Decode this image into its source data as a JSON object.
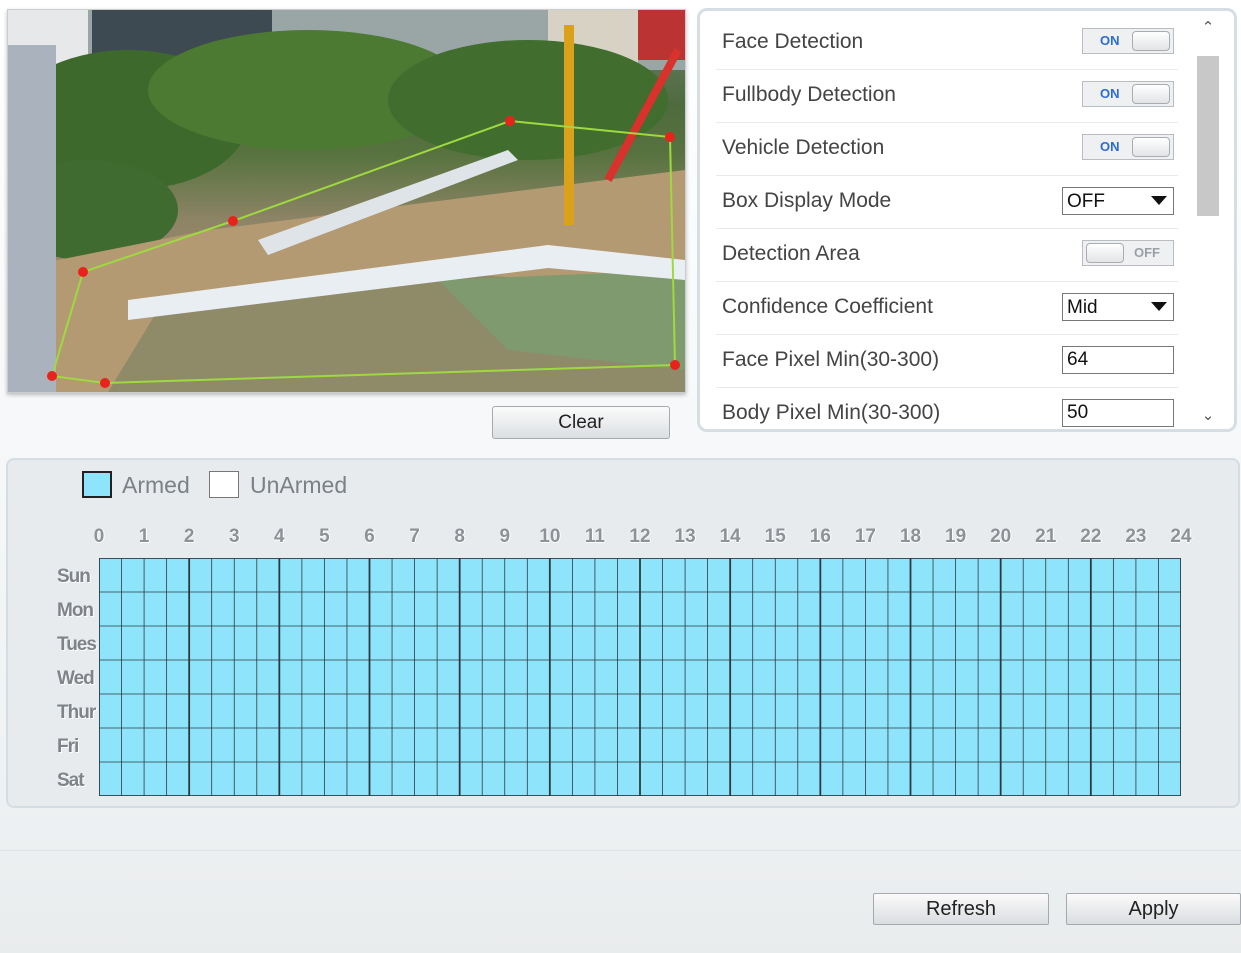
{
  "preview": {
    "clear_label": "Clear",
    "colors": {
      "region_line": "#9fd940",
      "region_point": "#e8231c"
    }
  },
  "settings": {
    "rows": [
      {
        "label": "Face Detection",
        "control": "toggle",
        "value": "ON"
      },
      {
        "label": "Fullbody Detection",
        "control": "toggle",
        "value": "ON"
      },
      {
        "label": "Vehicle Detection",
        "control": "toggle",
        "value": "ON"
      },
      {
        "label": "Box Display Mode",
        "control": "select",
        "value": "OFF"
      },
      {
        "label": "Detection Area",
        "control": "toggle",
        "value": "OFF"
      },
      {
        "label": "Confidence Coefficient",
        "control": "select",
        "value": "Mid"
      },
      {
        "label": "Face Pixel Min(30-300)",
        "control": "input",
        "value": "64"
      },
      {
        "label": "Body Pixel Min(30-300)",
        "control": "input",
        "value": "50"
      }
    ],
    "scroll_up_icon": "chevron-up-icon",
    "scroll_down_icon": "chevron-down-icon"
  },
  "schedule": {
    "legend": {
      "armed": "Armed",
      "unarmed": "UnArmed"
    },
    "hours": [
      "0",
      "1",
      "2",
      "3",
      "4",
      "5",
      "6",
      "7",
      "8",
      "9",
      "10",
      "11",
      "12",
      "13",
      "14",
      "15",
      "16",
      "17",
      "18",
      "19",
      "20",
      "21",
      "22",
      "23",
      "24"
    ],
    "days": [
      "Sun",
      "Mon",
      "Tues",
      "Wed",
      "Thur",
      "Fri",
      "Sat"
    ],
    "armed_all": true,
    "colors": {
      "armed": "#8ee5fb",
      "grid": "#2d3a40"
    }
  },
  "footer": {
    "refresh_label": "Refresh",
    "apply_label": "Apply"
  }
}
